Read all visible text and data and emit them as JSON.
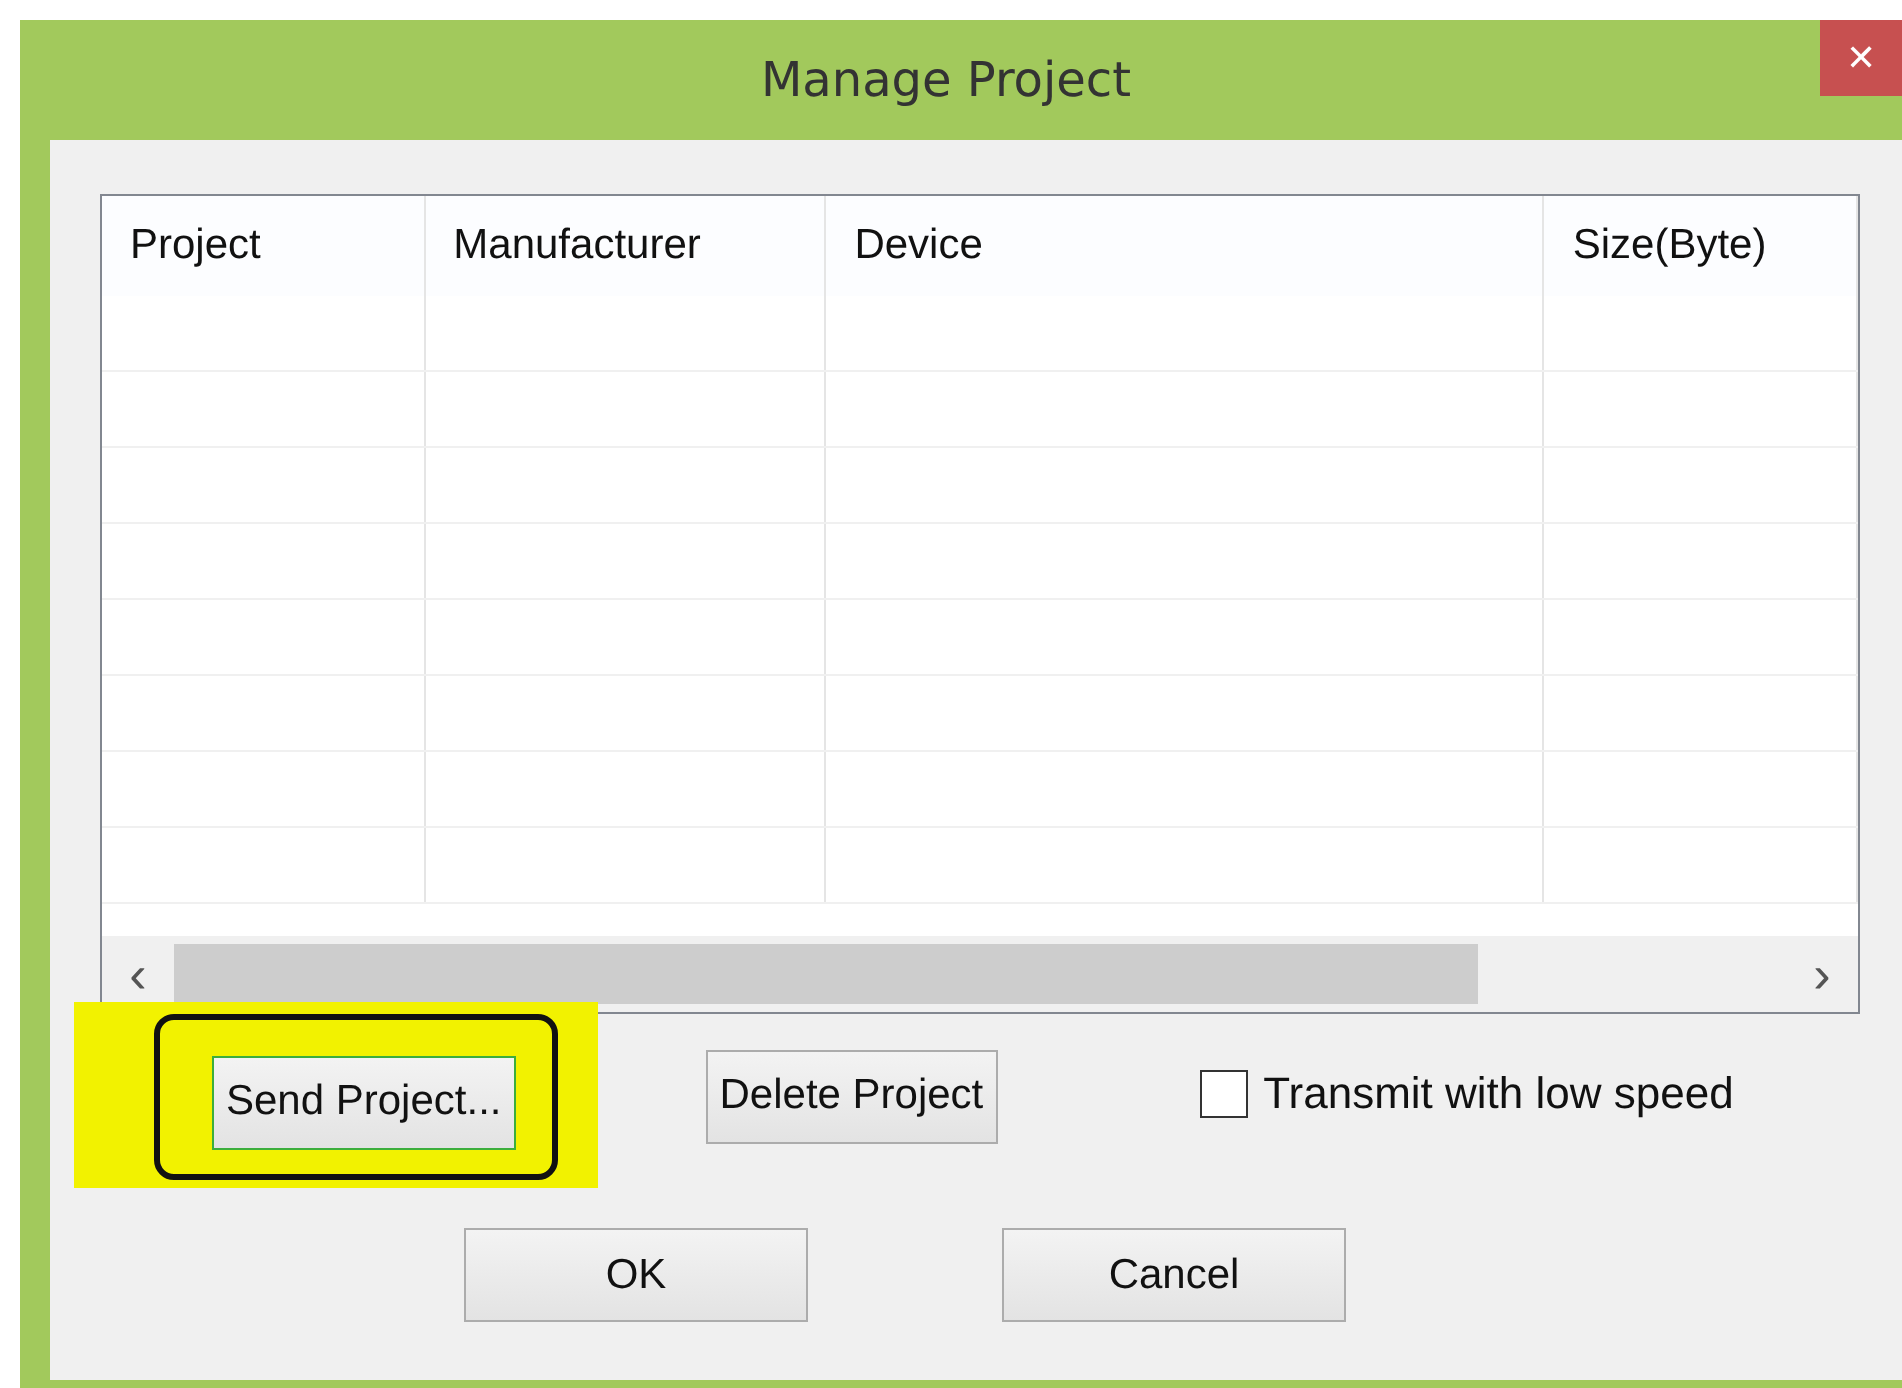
{
  "window": {
    "title": "Manage Project",
    "close": "✕"
  },
  "table": {
    "columns": [
      "Project",
      "Manufacturer",
      "Device",
      "Size(Byte)"
    ],
    "scroll_left": "‹",
    "scroll_right": "›"
  },
  "buttons": [
    {
      "label": "Send Project...",
      "highlighted": true
    },
    {
      "label": "Delete Project",
      "highlighted": false
    }
  ],
  "options": [
    {
      "label": "Transmit with low speed",
      "checked": false
    }
  ],
  "footer_buttons": [
    "OK",
    "Cancel"
  ]
}
